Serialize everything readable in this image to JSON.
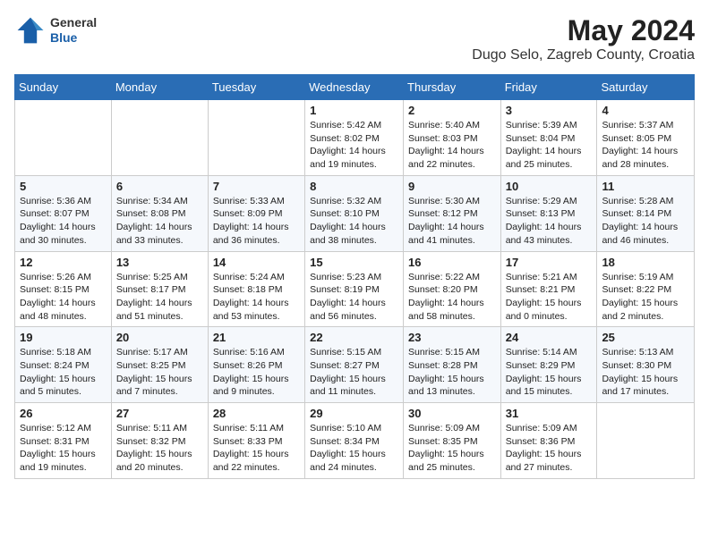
{
  "header": {
    "logo": {
      "general": "General",
      "blue": "Blue"
    },
    "title": "May 2024",
    "location": "Dugo Selo, Zagreb County, Croatia"
  },
  "weekdays": [
    "Sunday",
    "Monday",
    "Tuesday",
    "Wednesday",
    "Thursday",
    "Friday",
    "Saturday"
  ],
  "weeks": [
    [
      {
        "day": "",
        "info": ""
      },
      {
        "day": "",
        "info": ""
      },
      {
        "day": "",
        "info": ""
      },
      {
        "day": "1",
        "info": "Sunrise: 5:42 AM\nSunset: 8:02 PM\nDaylight: 14 hours\nand 19 minutes."
      },
      {
        "day": "2",
        "info": "Sunrise: 5:40 AM\nSunset: 8:03 PM\nDaylight: 14 hours\nand 22 minutes."
      },
      {
        "day": "3",
        "info": "Sunrise: 5:39 AM\nSunset: 8:04 PM\nDaylight: 14 hours\nand 25 minutes."
      },
      {
        "day": "4",
        "info": "Sunrise: 5:37 AM\nSunset: 8:05 PM\nDaylight: 14 hours\nand 28 minutes."
      }
    ],
    [
      {
        "day": "5",
        "info": "Sunrise: 5:36 AM\nSunset: 8:07 PM\nDaylight: 14 hours\nand 30 minutes."
      },
      {
        "day": "6",
        "info": "Sunrise: 5:34 AM\nSunset: 8:08 PM\nDaylight: 14 hours\nand 33 minutes."
      },
      {
        "day": "7",
        "info": "Sunrise: 5:33 AM\nSunset: 8:09 PM\nDaylight: 14 hours\nand 36 minutes."
      },
      {
        "day": "8",
        "info": "Sunrise: 5:32 AM\nSunset: 8:10 PM\nDaylight: 14 hours\nand 38 minutes."
      },
      {
        "day": "9",
        "info": "Sunrise: 5:30 AM\nSunset: 8:12 PM\nDaylight: 14 hours\nand 41 minutes."
      },
      {
        "day": "10",
        "info": "Sunrise: 5:29 AM\nSunset: 8:13 PM\nDaylight: 14 hours\nand 43 minutes."
      },
      {
        "day": "11",
        "info": "Sunrise: 5:28 AM\nSunset: 8:14 PM\nDaylight: 14 hours\nand 46 minutes."
      }
    ],
    [
      {
        "day": "12",
        "info": "Sunrise: 5:26 AM\nSunset: 8:15 PM\nDaylight: 14 hours\nand 48 minutes."
      },
      {
        "day": "13",
        "info": "Sunrise: 5:25 AM\nSunset: 8:17 PM\nDaylight: 14 hours\nand 51 minutes."
      },
      {
        "day": "14",
        "info": "Sunrise: 5:24 AM\nSunset: 8:18 PM\nDaylight: 14 hours\nand 53 minutes."
      },
      {
        "day": "15",
        "info": "Sunrise: 5:23 AM\nSunset: 8:19 PM\nDaylight: 14 hours\nand 56 minutes."
      },
      {
        "day": "16",
        "info": "Sunrise: 5:22 AM\nSunset: 8:20 PM\nDaylight: 14 hours\nand 58 minutes."
      },
      {
        "day": "17",
        "info": "Sunrise: 5:21 AM\nSunset: 8:21 PM\nDaylight: 15 hours\nand 0 minutes."
      },
      {
        "day": "18",
        "info": "Sunrise: 5:19 AM\nSunset: 8:22 PM\nDaylight: 15 hours\nand 2 minutes."
      }
    ],
    [
      {
        "day": "19",
        "info": "Sunrise: 5:18 AM\nSunset: 8:24 PM\nDaylight: 15 hours\nand 5 minutes."
      },
      {
        "day": "20",
        "info": "Sunrise: 5:17 AM\nSunset: 8:25 PM\nDaylight: 15 hours\nand 7 minutes."
      },
      {
        "day": "21",
        "info": "Sunrise: 5:16 AM\nSunset: 8:26 PM\nDaylight: 15 hours\nand 9 minutes."
      },
      {
        "day": "22",
        "info": "Sunrise: 5:15 AM\nSunset: 8:27 PM\nDaylight: 15 hours\nand 11 minutes."
      },
      {
        "day": "23",
        "info": "Sunrise: 5:15 AM\nSunset: 8:28 PM\nDaylight: 15 hours\nand 13 minutes."
      },
      {
        "day": "24",
        "info": "Sunrise: 5:14 AM\nSunset: 8:29 PM\nDaylight: 15 hours\nand 15 minutes."
      },
      {
        "day": "25",
        "info": "Sunrise: 5:13 AM\nSunset: 8:30 PM\nDaylight: 15 hours\nand 17 minutes."
      }
    ],
    [
      {
        "day": "26",
        "info": "Sunrise: 5:12 AM\nSunset: 8:31 PM\nDaylight: 15 hours\nand 19 minutes."
      },
      {
        "day": "27",
        "info": "Sunrise: 5:11 AM\nSunset: 8:32 PM\nDaylight: 15 hours\nand 20 minutes."
      },
      {
        "day": "28",
        "info": "Sunrise: 5:11 AM\nSunset: 8:33 PM\nDaylight: 15 hours\nand 22 minutes."
      },
      {
        "day": "29",
        "info": "Sunrise: 5:10 AM\nSunset: 8:34 PM\nDaylight: 15 hours\nand 24 minutes."
      },
      {
        "day": "30",
        "info": "Sunrise: 5:09 AM\nSunset: 8:35 PM\nDaylight: 15 hours\nand 25 minutes."
      },
      {
        "day": "31",
        "info": "Sunrise: 5:09 AM\nSunset: 8:36 PM\nDaylight: 15 hours\nand 27 minutes."
      },
      {
        "day": "",
        "info": ""
      }
    ]
  ]
}
